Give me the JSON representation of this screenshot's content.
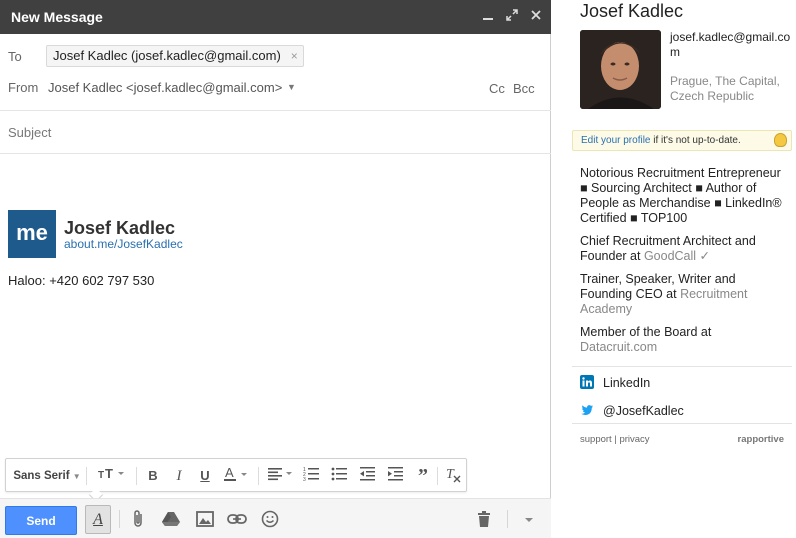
{
  "compose": {
    "title": "New Message",
    "to_label": "To",
    "to_recipient": "Josef Kadlec (josef.kadlec@gmail.com)",
    "chip_remove": "×",
    "from_label": "From",
    "from_value": "Josef Kadlec <josef.kadlec@gmail.com>",
    "cc_label": "Cc",
    "bcc_label": "Bcc",
    "subject_placeholder": "Subject",
    "signature": {
      "logo_text": "me",
      "name": "Josef Kadlec",
      "link": "about.me/JosefKadlec",
      "phone_line": "Haloo: +420 602 797 530"
    },
    "font_family": "Sans Serif",
    "send_label": "Send",
    "window_icons": [
      "minimize-icon",
      "popout-icon",
      "close-icon"
    ],
    "toolbar_icons": [
      "text-size-icon",
      "bold-icon",
      "italic-icon",
      "underline-icon",
      "text-color-icon",
      "align-icon",
      "numbered-list-icon",
      "bulleted-list-icon",
      "indent-less-icon",
      "indent-more-icon",
      "quote-icon",
      "remove-formatting-icon"
    ],
    "bottom_icons": [
      "attach-icon",
      "drive-icon",
      "photo-icon",
      "link-icon",
      "emoji-icon",
      "trash-icon",
      "more-options-icon"
    ]
  },
  "sidebar": {
    "name": "Josef Kadlec",
    "email": "josef.kadlec@gmail.com",
    "location": "Prague, The Capital, Czech Republic",
    "edit_link": "Edit your profile",
    "edit_rest": " if it's not up-to-date.",
    "bio": {
      "p1": "Notorious Recruitment Entrepreneur ■ Sourcing Architect ■ Author of People as Merchandise ■ LinkedIn® Certified ■ TOP100",
      "p2_text": "Chief Recruitment Architect and Founder at ",
      "p2_org": "GoodCall ✓",
      "p3_text": "Trainer, Speaker, Writer and Founding CEO at ",
      "p3_org": "Recruitment Academy",
      "p4_text": "Member of the Board at ",
      "p4_org": "Datacruit.com"
    },
    "social": [
      {
        "label": "LinkedIn",
        "icon": "linkedin-icon",
        "color": "#0077b5"
      },
      {
        "label": "@JosefKadlec",
        "icon": "twitter-icon",
        "color": "#1da1f2"
      }
    ],
    "footer": {
      "support": "support",
      "sep": " | ",
      "privacy": "privacy",
      "brand": "rapportive"
    }
  },
  "colors": {
    "titlebar": "#404040",
    "send": "#4d90fe",
    "link": "#2a6fb0",
    "logo": "#1f5a8c"
  }
}
